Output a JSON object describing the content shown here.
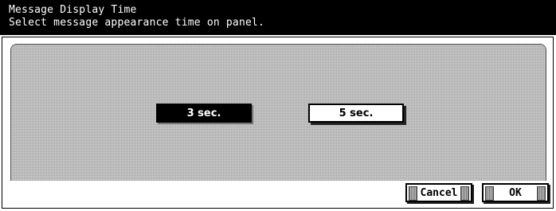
{
  "header": {
    "title": "Message Display Time",
    "subtitle": "Select message appearance time on panel."
  },
  "options": [
    {
      "label": "3 sec.",
      "selected": true
    },
    {
      "label": "5 sec.",
      "selected": false
    }
  ],
  "actions": {
    "cancel_label": "Cancel",
    "ok_label": "OK"
  },
  "colors": {
    "header_bg": "#000000",
    "header_text": "#ffffff",
    "selected_bg": "#000000",
    "selected_text": "#ffffff",
    "panel_bg": "#ffffff",
    "dither": "#d0d0d0"
  }
}
